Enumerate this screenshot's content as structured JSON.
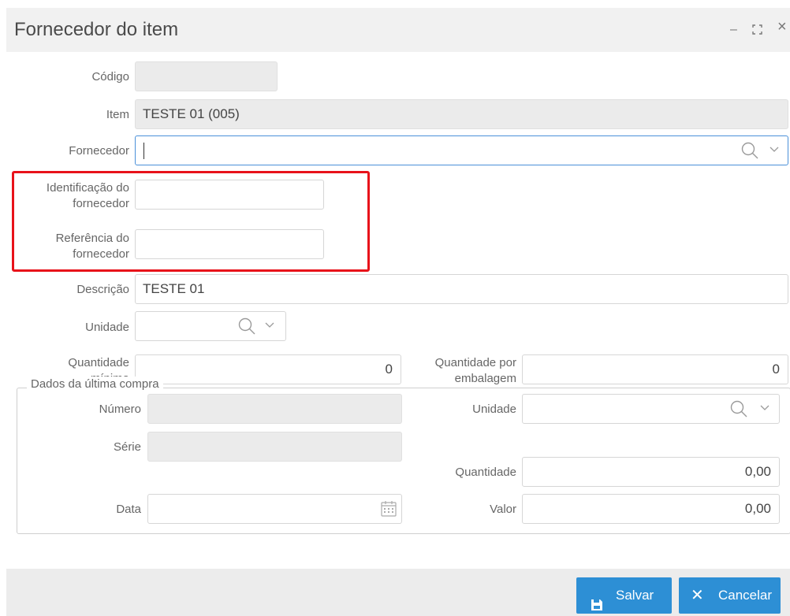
{
  "dialog": {
    "title": "Fornecedor do item",
    "window_controls": {
      "minimize": "–",
      "maximize": "⛶",
      "close": "×"
    }
  },
  "form": {
    "codigo": {
      "label": "Código",
      "value": ""
    },
    "item": {
      "label": "Item",
      "value": "TESTE 01 (005)"
    },
    "fornecedor": {
      "label": "Fornecedor",
      "value": ""
    },
    "identificacao": {
      "label_line1": "Identificação do",
      "label_line2": "fornecedor",
      "value": ""
    },
    "referencia": {
      "label_line1": "Referência do",
      "label_line2": "fornecedor",
      "value": ""
    },
    "descricao": {
      "label": "Descrição",
      "value": "TESTE 01"
    },
    "unidade": {
      "label": "Unidade",
      "value": ""
    },
    "quantidade_minima": {
      "label_line1": "Quantidade",
      "label_line2": "mínima",
      "value": "0"
    },
    "quantidade_embalagem": {
      "label_line1": "Quantidade por",
      "label_line2": "embalagem",
      "value": "0"
    }
  },
  "ultima_compra": {
    "legend": "Dados da última compra",
    "numero": {
      "label": "Número",
      "value": ""
    },
    "serie": {
      "label": "Série",
      "value": ""
    },
    "data": {
      "label": "Data",
      "value": ""
    },
    "unidade": {
      "label": "Unidade",
      "value": ""
    },
    "quantidade": {
      "label": "Quantidade",
      "value": "0,00"
    },
    "valor": {
      "label": "Valor",
      "value": "0,00"
    }
  },
  "footer": {
    "save_label": "Salvar",
    "cancel_label": "Cancelar"
  },
  "colors": {
    "accent": "#2d8fd5",
    "highlight": "#e8121a",
    "readonly_bg": "#ebebeb"
  }
}
